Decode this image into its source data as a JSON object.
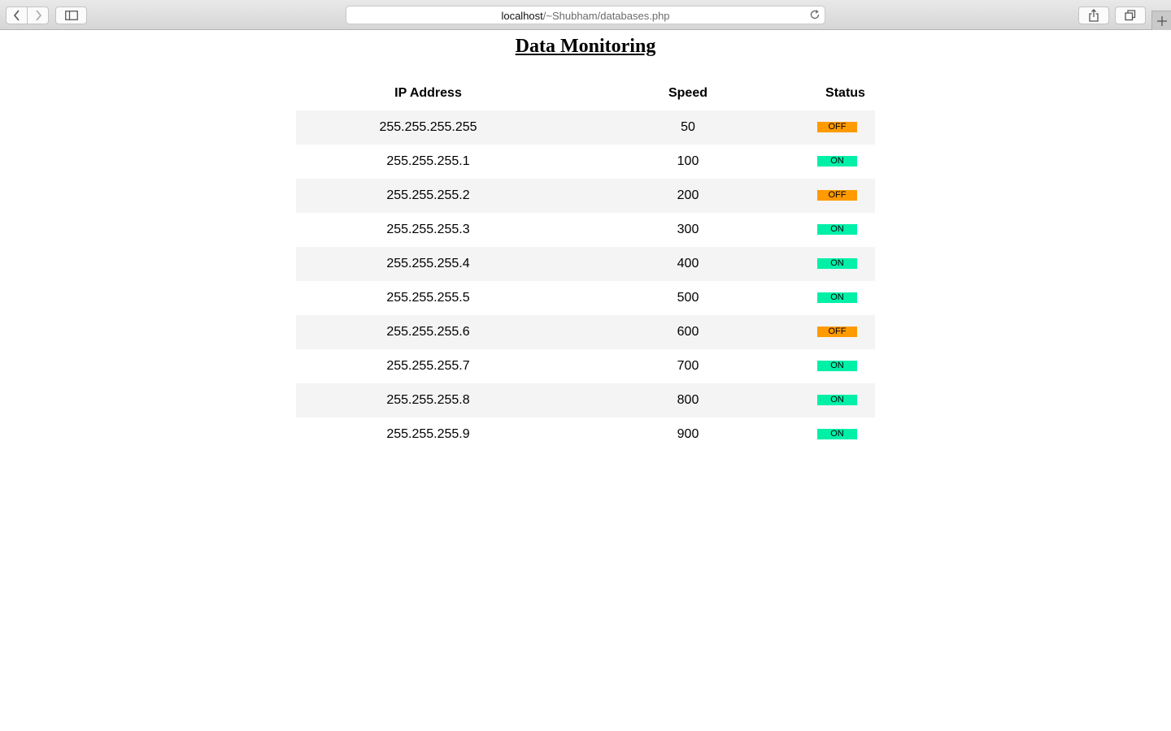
{
  "browser": {
    "url_host": "localhost",
    "url_path": "/~Shubham/databases.php"
  },
  "page": {
    "title": "Data Monitoring"
  },
  "table": {
    "headers": [
      "IP Address",
      "Speed",
      "Status"
    ],
    "rows": [
      {
        "ip": "255.255.255.255",
        "speed": "50",
        "status": "OFF"
      },
      {
        "ip": "255.255.255.1",
        "speed": "100",
        "status": "ON"
      },
      {
        "ip": "255.255.255.2",
        "speed": "200",
        "status": "OFF"
      },
      {
        "ip": "255.255.255.3",
        "speed": "300",
        "status": "ON"
      },
      {
        "ip": "255.255.255.4",
        "speed": "400",
        "status": "ON"
      },
      {
        "ip": "255.255.255.5",
        "speed": "500",
        "status": "ON"
      },
      {
        "ip": "255.255.255.6",
        "speed": "600",
        "status": "OFF"
      },
      {
        "ip": "255.255.255.7",
        "speed": "700",
        "status": "ON"
      },
      {
        "ip": "255.255.255.8",
        "speed": "800",
        "status": "ON"
      },
      {
        "ip": "255.255.255.9",
        "speed": "900",
        "status": "ON"
      }
    ]
  },
  "colors": {
    "status_on": "#00f0a8",
    "status_off": "#ff9a00",
    "row_stripe": "#f4f4f4"
  },
  "icons": [
    "back-icon",
    "forward-icon",
    "sidebar-icon",
    "reload-icon",
    "share-icon",
    "tabs-icon",
    "plus-icon"
  ]
}
